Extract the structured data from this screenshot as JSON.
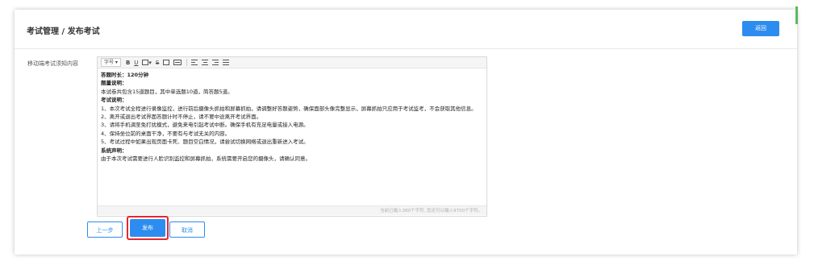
{
  "header": {
    "title": "考试管理 / 发布考试",
    "back_label": "返回"
  },
  "form": {
    "field_label": "移动端考试须知内容"
  },
  "toolbar": {
    "font_select": "字号",
    "bold": "B",
    "underline": "U",
    "strike": "S"
  },
  "editor": {
    "lines": [
      "答题时长：120分钟",
      "题量说明：",
      "本试卷共包含15道题目，其中单选题10道，简答题5道。",
      "考试说明：",
      "1、本次考试全程进行录像监控，进行前后摄像头抓拍和屏幕抓拍，请调整好答题姿势，确保面部头像完整显示，屏幕抓拍只应用于考试监考，不会获取其他信息。",
      "2、离开或退出考试界面答题计时不停止，请不要中途离开考试界面。",
      "3、请将手机调至免打扰模式，避免来电引起考试中断。确保手机有充足电量或接入电源。",
      "4、保持坐位前的桌面干净，不要有与考试无关的内容。",
      "5、考试过程中如果出现页面卡死、题目空白情况，请尝试切换网络或退出重新进入考试。",
      "系统声明：",
      "由于本次考试需要进行人脸识别监控和屏幕抓拍，系统需要开启您的摄像头，请确认同意。"
    ],
    "counter": "当前已输入380个字符, 您还可以输入9700个字符。"
  },
  "actions": {
    "prev_label": "上一步",
    "publish_label": "发布",
    "cancel_label": "取消"
  },
  "colors": {
    "accent": "#2d8cf0",
    "highlight": "#e8262c"
  }
}
